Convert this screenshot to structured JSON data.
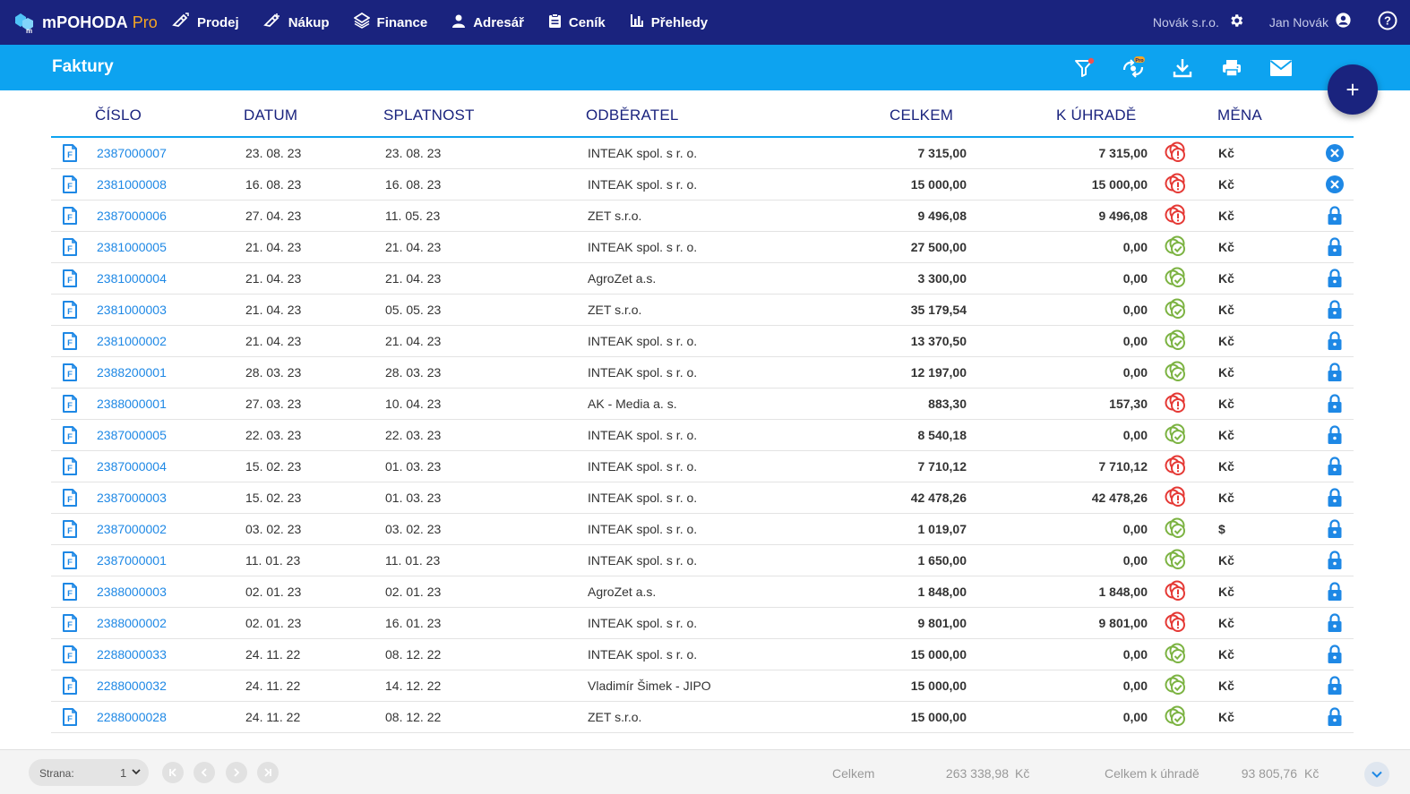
{
  "app": {
    "brand_name": "mPOHODA",
    "brand_tier": "Pro",
    "nav": [
      {
        "label": "Prodej",
        "icon": "sale-icon"
      },
      {
        "label": "Nákup",
        "icon": "purchase-icon"
      },
      {
        "label": "Finance",
        "icon": "finance-icon"
      },
      {
        "label": "Adresář",
        "icon": "person-icon"
      },
      {
        "label": "Ceník",
        "icon": "pricelist-icon"
      },
      {
        "label": "Přehledy",
        "icon": "bar-chart-icon"
      }
    ],
    "company": "Novák s.r.o.",
    "user": "Jan Novák"
  },
  "page": {
    "title": "Faktury",
    "toolbar_icons": [
      "filter-icon",
      "pro-settings-icon",
      "download-icon",
      "print-icon",
      "mail-icon"
    ],
    "add_button": "+"
  },
  "table": {
    "headers": {
      "number": "ČÍSLO",
      "date": "DATUM",
      "due": "SPLATNOST",
      "customer": "ODBĚRATEL",
      "total": "CELKEM",
      "to_pay": "K ÚHRADĚ",
      "currency": "MĚNA"
    },
    "rows": [
      {
        "number": "2387000007",
        "date": "23. 08. 23",
        "due": "23. 08. 23",
        "customer": "INTEAK spol. s r. o.",
        "total": "7 315,00",
        "to_pay": "7 315,00",
        "paid": false,
        "currency": "Kč",
        "action": "cancel"
      },
      {
        "number": "2381000008",
        "date": "16. 08. 23",
        "due": "16. 08. 23",
        "customer": "INTEAK spol. s r. o.",
        "total": "15 000,00",
        "to_pay": "15 000,00",
        "paid": false,
        "currency": "Kč",
        "action": "cancel"
      },
      {
        "number": "2387000006",
        "date": "27. 04. 23",
        "due": "11. 05. 23",
        "customer": "ZET s.r.o.",
        "total": "9 496,08",
        "to_pay": "9 496,08",
        "paid": false,
        "currency": "Kč",
        "action": "lock"
      },
      {
        "number": "2381000005",
        "date": "21. 04. 23",
        "due": "21. 04. 23",
        "customer": "INTEAK spol. s r. o.",
        "total": "27 500,00",
        "to_pay": "0,00",
        "paid": true,
        "currency": "Kč",
        "action": "lock"
      },
      {
        "number": "2381000004",
        "date": "21. 04. 23",
        "due": "21. 04. 23",
        "customer": "AgroZet a.s.",
        "total": "3 300,00",
        "to_pay": "0,00",
        "paid": true,
        "currency": "Kč",
        "action": "lock"
      },
      {
        "number": "2381000003",
        "date": "21. 04. 23",
        "due": "05. 05. 23",
        "customer": "ZET s.r.o.",
        "total": "35 179,54",
        "to_pay": "0,00",
        "paid": true,
        "currency": "Kč",
        "action": "lock"
      },
      {
        "number": "2381000002",
        "date": "21. 04. 23",
        "due": "21. 04. 23",
        "customer": "INTEAK spol. s r. o.",
        "total": "13 370,50",
        "to_pay": "0,00",
        "paid": true,
        "currency": "Kč",
        "action": "lock"
      },
      {
        "number": "2388200001",
        "date": "28. 03. 23",
        "due": "28. 03. 23",
        "customer": "INTEAK spol. s r. o.",
        "total": "12 197,00",
        "to_pay": "0,00",
        "paid": true,
        "currency": "Kč",
        "action": "lock"
      },
      {
        "number": "2388000001",
        "date": "27. 03. 23",
        "due": "10. 04. 23",
        "customer": "AK - Media a. s.",
        "total": "883,30",
        "to_pay": "157,30",
        "paid": false,
        "currency": "Kč",
        "action": "lock"
      },
      {
        "number": "2387000005",
        "date": "22. 03. 23",
        "due": "22. 03. 23",
        "customer": "INTEAK spol. s r. o.",
        "total": "8 540,18",
        "to_pay": "0,00",
        "paid": true,
        "currency": "Kč",
        "action": "lock"
      },
      {
        "number": "2387000004",
        "date": "15. 02. 23",
        "due": "01. 03. 23",
        "customer": "INTEAK spol. s r. o.",
        "total": "7 710,12",
        "to_pay": "7 710,12",
        "paid": false,
        "currency": "Kč",
        "action": "lock"
      },
      {
        "number": "2387000003",
        "date": "15. 02. 23",
        "due": "01. 03. 23",
        "customer": "INTEAK spol. s r. o.",
        "total": "42 478,26",
        "to_pay": "42 478,26",
        "paid": false,
        "currency": "Kč",
        "action": "lock"
      },
      {
        "number": "2387000002",
        "date": "03. 02. 23",
        "due": "03. 02. 23",
        "customer": "INTEAK spol. s r. o.",
        "total": "1 019,07",
        "to_pay": "0,00",
        "paid": true,
        "currency": "$",
        "action": "lock"
      },
      {
        "number": "2387000001",
        "date": "11. 01. 23",
        "due": "11. 01. 23",
        "customer": "INTEAK spol. s r. o.",
        "total": "1 650,00",
        "to_pay": "0,00",
        "paid": true,
        "currency": "Kč",
        "action": "lock"
      },
      {
        "number": "2388000003",
        "date": "02. 01. 23",
        "due": "02. 01. 23",
        "customer": "AgroZet a.s.",
        "total": "1 848,00",
        "to_pay": "1 848,00",
        "paid": false,
        "currency": "Kč",
        "action": "lock"
      },
      {
        "number": "2388000002",
        "date": "02. 01. 23",
        "due": "16. 01. 23",
        "customer": "INTEAK spol. s r. o.",
        "total": "9 801,00",
        "to_pay": "9 801,00",
        "paid": false,
        "currency": "Kč",
        "action": "lock"
      },
      {
        "number": "2288000033",
        "date": "24. 11. 22",
        "due": "08. 12. 22",
        "customer": "INTEAK spol. s r. o.",
        "total": "15 000,00",
        "to_pay": "0,00",
        "paid": true,
        "currency": "Kč",
        "action": "lock"
      },
      {
        "number": "2288000032",
        "date": "24. 11. 22",
        "due": "14. 12. 22",
        "customer": "Vladimír Šimek - JIPO",
        "total": "15 000,00",
        "to_pay": "0,00",
        "paid": true,
        "currency": "Kč",
        "action": "lock"
      },
      {
        "number": "2288000028",
        "date": "24. 11. 22",
        "due": "08. 12. 22",
        "customer": "ZET s.r.o.",
        "total": "15 000,00",
        "to_pay": "0,00",
        "paid": true,
        "currency": "Kč",
        "action": "lock"
      }
    ]
  },
  "footer": {
    "page_label": "Strana:",
    "page_value": "1",
    "total_label": "Celkem",
    "total_value": "263 338,98",
    "total_currency": "Kč",
    "to_pay_label": "Celkem k úhradě",
    "to_pay_value": "93 805,76",
    "to_pay_currency": "Kč"
  },
  "colors": {
    "topbar": "#1a237e",
    "subbar": "#0da3f0",
    "link": "#1e88e5",
    "unpaid": "#e53935",
    "paid": "#7cb342",
    "action": "#1e88e5"
  }
}
